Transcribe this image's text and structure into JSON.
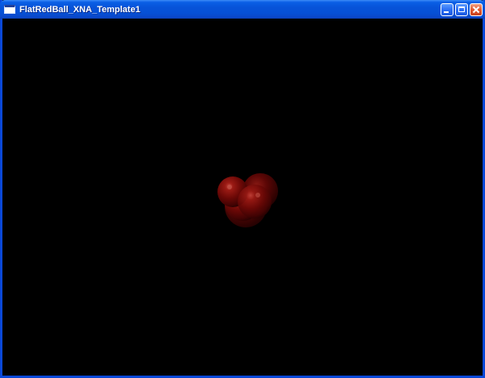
{
  "window": {
    "title": "FlatRedBall_XNA_Template1",
    "icon": "window-app-icon"
  },
  "caption_buttons": [
    {
      "name": "minimize-button",
      "icon": "minimize-icon"
    },
    {
      "name": "maximize-button",
      "icon": "maximize-icon"
    },
    {
      "name": "close-button",
      "icon": "close-icon"
    }
  ],
  "colors": {
    "titlebar": "#0753d8",
    "viewport_background": "#000000",
    "sphere": "#7a0b08",
    "close_button": "#e2582f"
  },
  "scene": {
    "description_icon": "red-spheres-cluster"
  }
}
